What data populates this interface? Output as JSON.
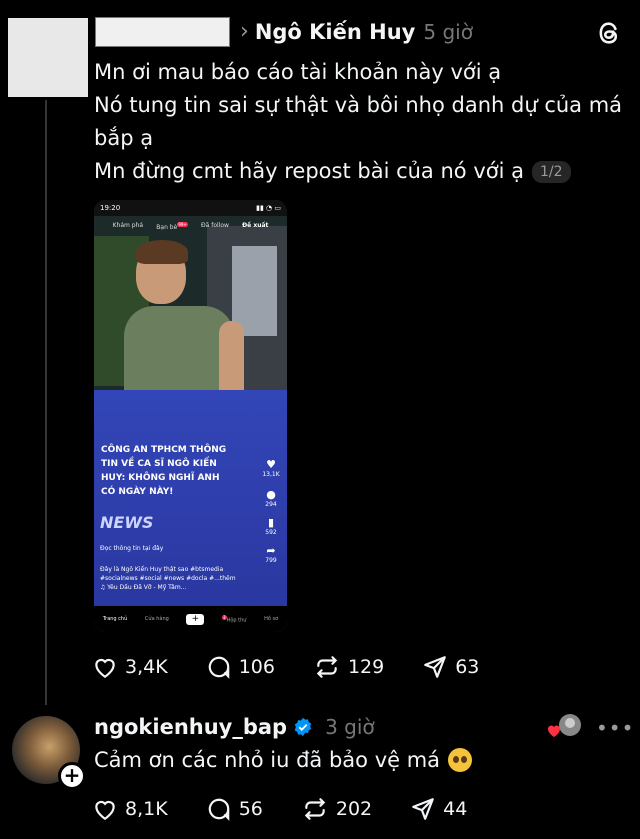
{
  "post": {
    "username": "Ngô Kiến Huy",
    "time": "5 giờ",
    "lines": [
      "Mn ơi mau báo cáo tài khoản này với ạ",
      "Nó tung tin sai sự thật và bôi nhọ danh dự của má bắp ạ",
      "Mn đừng cmt hãy repost bài của nó với ạ"
    ],
    "pager": "1/2",
    "stats": {
      "likes": "3,4K",
      "comments": "106",
      "reposts": "129",
      "shares": "63"
    }
  },
  "phone": {
    "status_time": "19:20",
    "tabs": [
      "Khám phá",
      "Bạn bè",
      "Đã follow",
      "Đề xuất"
    ],
    "tab_badge": "99+",
    "headline": "CÔNG AN TPHCM THÔNG TIN VỀ CA SĨ NGÔ KIẾN HUY: KHÔNG NGHĨ ANH CÓ NGÀY NÀY!",
    "news_logo": "NEWS",
    "read_more": "Đọc thông tin tại đây",
    "caption": "Đây là Ngô Kiến Huy thật sao #btsmedia #socialnews #social #news #docla #...thêm",
    "music": "♫ Yêu Dấu Đã Vỡ - Mỹ Tâm...",
    "side": {
      "likes": "13,1K",
      "comments": "294",
      "saves": "592",
      "shares": "799"
    },
    "nav": [
      "Trang chủ",
      "Cửa hàng",
      "Hộp thư",
      "Hồ sơ"
    ],
    "nav_badge": "3"
  },
  "reply": {
    "username": "ngokienhuy_bap",
    "time": "3 giờ",
    "text": "Cảm ơn các nhỏ iu đã bảo vệ má",
    "stats": {
      "likes": "8,1K",
      "comments": "56",
      "reposts": "202",
      "shares": "44"
    }
  },
  "colors": {
    "background": "#000000",
    "text": "#f3f5f7",
    "muted": "#777777",
    "verified": "#0095f6",
    "line": "#333638",
    "like_heart": "#ff3040"
  },
  "icons": [
    "threads-logo-icon",
    "chevron-right-icon",
    "heart-icon",
    "comment-icon",
    "repost-icon",
    "share-icon",
    "verified-icon",
    "more-icon",
    "plus-icon"
  ]
}
